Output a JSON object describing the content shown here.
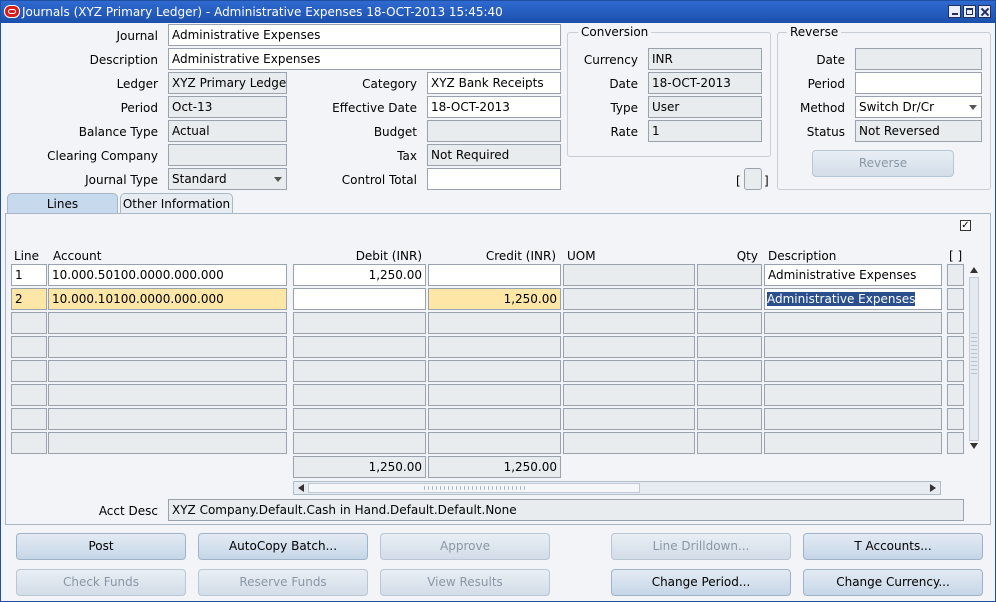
{
  "window": {
    "title": "Journals (XYZ Primary Ledger) - Administrative Expenses 18-OCT-2013 15:45:40"
  },
  "header": {
    "journal_label": "Journal",
    "journal_value": "Administrative Expenses",
    "description_label": "Description",
    "description_value": "Administrative Expenses",
    "ledger_label": "Ledger",
    "ledger_value": "XYZ Primary Ledger",
    "period_label": "Period",
    "period_value": "Oct-13",
    "balance_type_label": "Balance Type",
    "balance_type_value": "Actual",
    "clearing_company_label": "Clearing Company",
    "clearing_company_value": "",
    "journal_type_label": "Journal Type",
    "journal_type_value": "Standard",
    "category_label": "Category",
    "category_value": "XYZ Bank Receipts",
    "effective_date_label": "Effective Date",
    "effective_date_value": "18-OCT-2013",
    "budget_label": "Budget",
    "budget_value": "",
    "tax_label": "Tax",
    "tax_value": "Not Required",
    "control_total_label": "Control Total",
    "control_total_value": ""
  },
  "conversion": {
    "title": "Conversion",
    "currency_label": "Currency",
    "currency_value": "INR",
    "date_label": "Date",
    "date_value": "18-OCT-2013",
    "type_label": "Type",
    "type_value": "User",
    "rate_label": "Rate",
    "rate_value": "1"
  },
  "reverse": {
    "title": "Reverse",
    "date_label": "Date",
    "date_value": "",
    "period_label": "Period",
    "period_value": "",
    "method_label": "Method",
    "method_value": "Switch Dr/Cr",
    "status_label": "Status",
    "status_value": "Not Reversed",
    "button_label": "Reverse"
  },
  "bracket_left": "[",
  "bracket_right": "]",
  "tabs": [
    {
      "label": "Lines"
    },
    {
      "label": "Other Information"
    }
  ],
  "lines": {
    "columns": {
      "line": "Line",
      "account": "Account",
      "debit": "Debit (INR)",
      "credit": "Credit (INR)",
      "uom": "UOM",
      "qty": "Qty",
      "description": "Description",
      "flex": "[ ]"
    },
    "rows": [
      {
        "line": "1",
        "account": "10.000.50100.0000.000.000",
        "debit": "1,250.00",
        "credit": "",
        "uom": "",
        "qty": "",
        "description": "Administrative Expenses"
      },
      {
        "line": "2",
        "account": "10.000.10100.0000.000.000",
        "debit": "",
        "credit": "1,250.00",
        "uom": "",
        "qty": "",
        "description": "Administrative Expenses"
      }
    ],
    "total_debit": "1,250.00",
    "total_credit": "1,250.00",
    "acct_desc_label": "Acct Desc",
    "acct_desc_value": "XYZ Company.Default.Cash in Hand.Default.Default.None"
  },
  "buttons": {
    "post": "Post",
    "autocopy": "AutoCopy Batch...",
    "approve": "Approve",
    "line_drilldown": "Line Drilldown...",
    "t_accounts": "T Accounts...",
    "check_funds": "Check Funds",
    "reserve_funds": "Reserve Funds",
    "view_results": "View Results",
    "change_period": "Change Period...",
    "change_currency": "Change Currency..."
  },
  "colors": {
    "title_bar": "#1c4fab",
    "selected_row": "#fde6a6",
    "selection_highlight": "#2a4f8c"
  }
}
